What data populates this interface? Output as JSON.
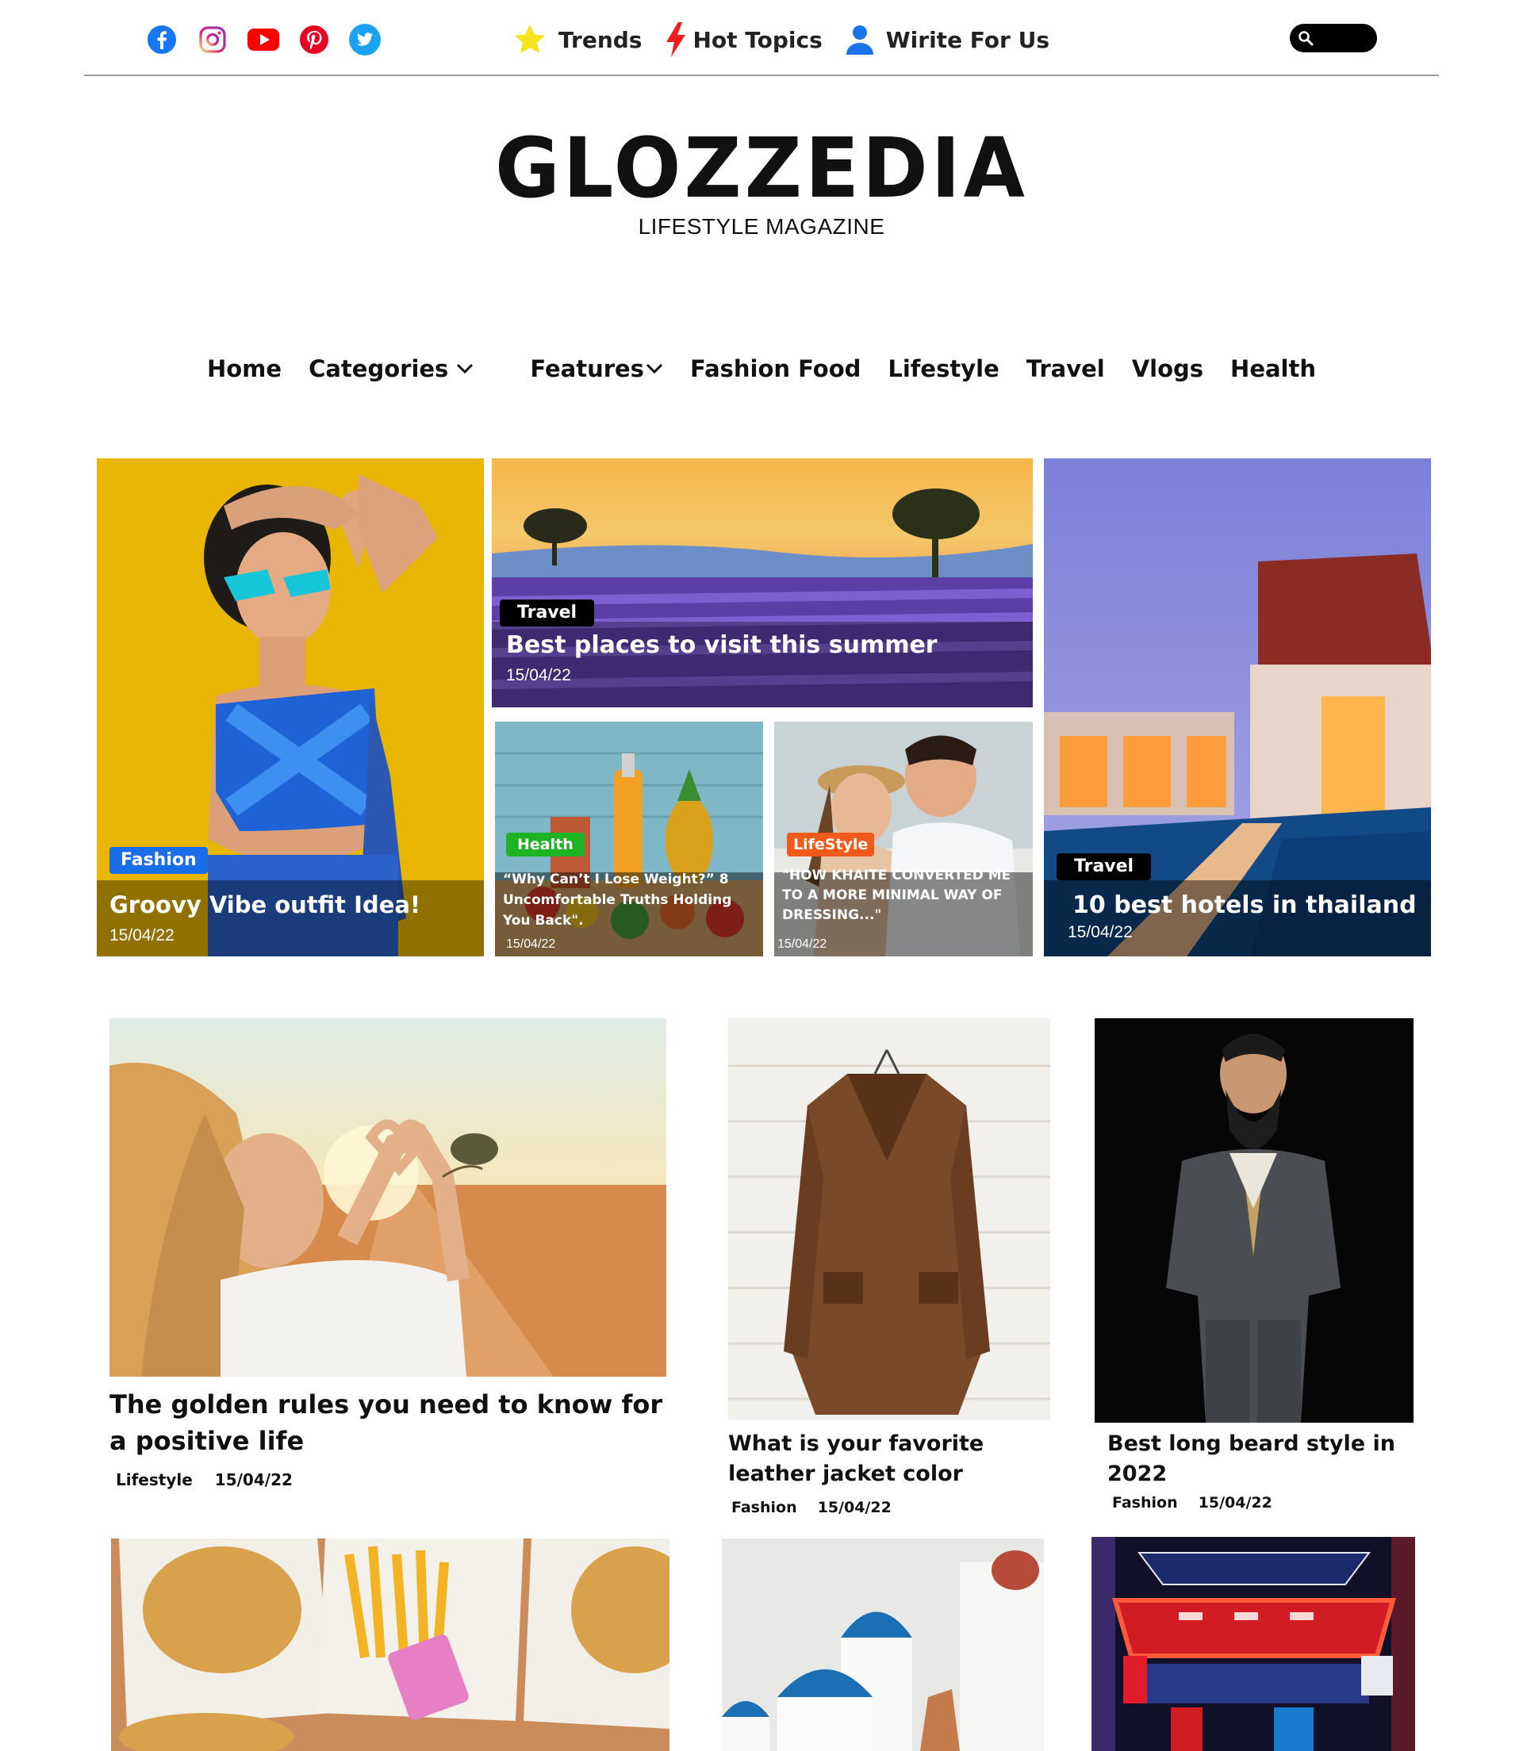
{
  "social": {
    "icons": [
      "facebook-icon",
      "instagram-icon",
      "youtube-icon",
      "pinterest-icon",
      "twitter-icon"
    ],
    "colors": {
      "facebook": "#1877f2",
      "instagram": "#d6249f",
      "youtube": "#ff0000",
      "pinterest": "#e60023",
      "twitter": "#1da1f2"
    }
  },
  "topnav": {
    "trends": "Trends",
    "hot_topics": "Hot Topics",
    "write_for_us": "Wirite For Us"
  },
  "logo": {
    "title": "GLOZZEDIA",
    "subtitle": "LIFESTYLE MAGAZINE"
  },
  "mainnav": {
    "home": "Home",
    "categories": "Categories",
    "features": "Features",
    "fashion_food": "Fashion Food",
    "lifestyle": "Lifestyle",
    "travel": "Travel",
    "vlogs": "Vlogs",
    "health": "Health"
  },
  "hero": {
    "fashion": {
      "tag": "Fashion",
      "title": "Groovy Vibe outfit Idea!",
      "date": "15/04/22"
    },
    "travel_summer": {
      "tag": "Travel",
      "title": "Best places to visit this summer",
      "date": "15/04/22"
    },
    "health": {
      "tag": "Health",
      "title": "“Why Can’t I Lose Weight?” 8 Uncomfortable Truths Holding You Back\".",
      "date": "15/04/22"
    },
    "lifestyle": {
      "tag": "LifeStyle",
      "title": "\"HOW KHAITE CONVERTED ME TO A MORE MINIMAL WAY OF DRESSING...\"",
      "date": "15/04/22"
    },
    "travel_thailand": {
      "tag": "Travel",
      "title": "10 best hotels in thailand",
      "date": "15/04/22"
    }
  },
  "posts": {
    "golden_rules": {
      "title": "The golden rules you need to know for a positive life",
      "category": "Lifestyle",
      "date": "15/04/22"
    },
    "leather_jacket": {
      "title": "What is your favorite leather jacket color",
      "category": "Fashion",
      "date": "15/04/22"
    },
    "beard": {
      "title": "Best long beard style in 2022",
      "category": "Fashion",
      "date": "15/04/22"
    }
  },
  "tag_colors": {
    "fashion": "#1a6fe8",
    "travel": "#000000",
    "health": "#1db322",
    "lifestyle": "#f05a1a"
  }
}
